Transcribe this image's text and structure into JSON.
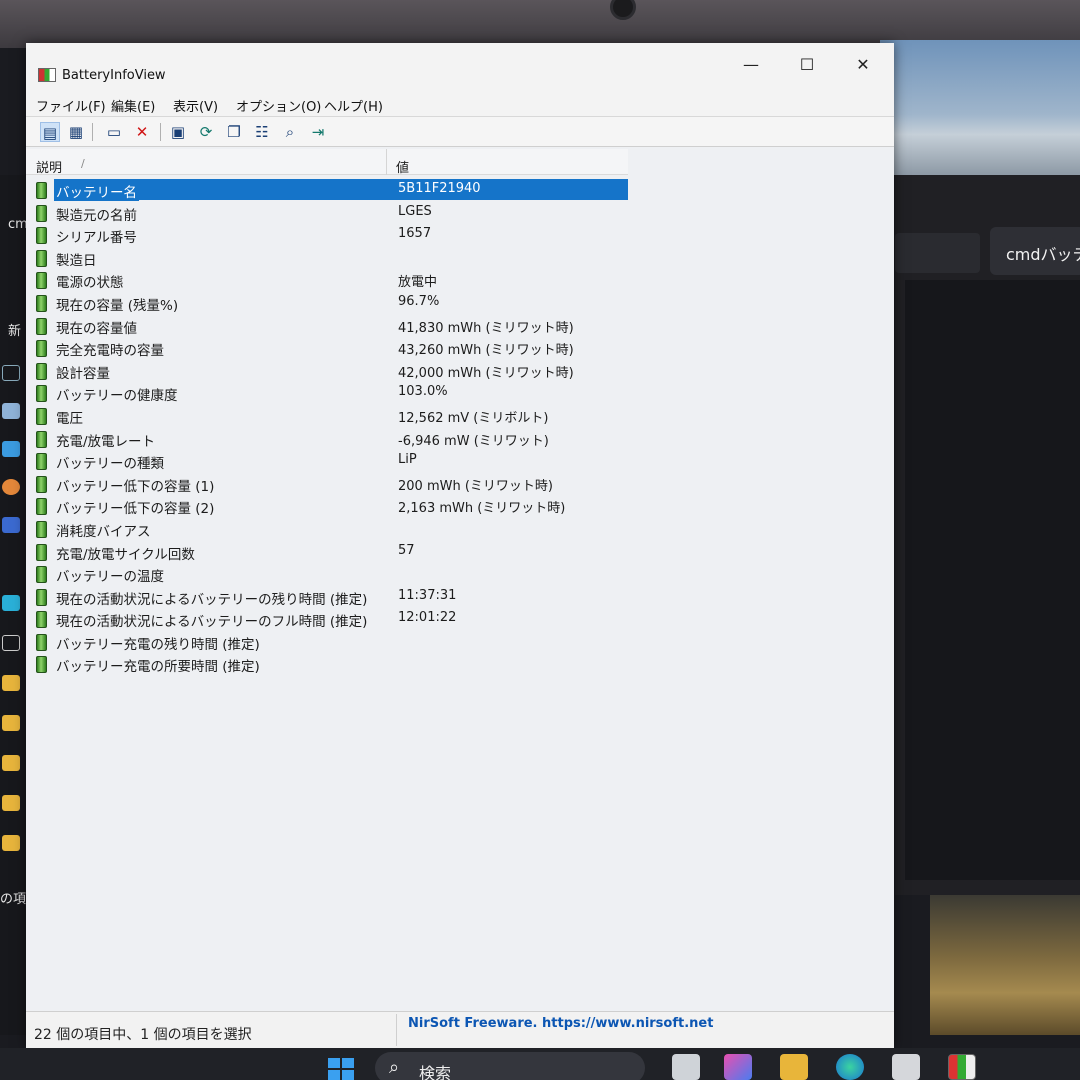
{
  "window": {
    "title": "BatteryInfoView",
    "minimize": "—",
    "maximize": "☐",
    "close": "✕"
  },
  "menu": [
    "ファイル(F)",
    "編集(E)",
    "表示(V)",
    "オプション(O)",
    "ヘルプ(H)"
  ],
  "columns": {
    "description": "説明",
    "sort_indicator": "∕",
    "value": "値"
  },
  "rows": [
    {
      "label": "バッテリー名",
      "value": "5B11F21940",
      "selected": true
    },
    {
      "label": "製造元の名前",
      "value": "LGES"
    },
    {
      "label": "シリアル番号",
      "value": "1657"
    },
    {
      "label": "製造日",
      "value": ""
    },
    {
      "label": "電源の状態",
      "value": "放電中"
    },
    {
      "label": "現在の容量 (残量%)",
      "value": "96.7%"
    },
    {
      "label": "現在の容量値",
      "value": "41,830 mWh (ミリワット時)"
    },
    {
      "label": "完全充電時の容量",
      "value": "43,260 mWh (ミリワット時)"
    },
    {
      "label": "設計容量",
      "value": "42,000 mWh (ミリワット時)"
    },
    {
      "label": "バッテリーの健康度",
      "value": "103.0%"
    },
    {
      "label": "電圧",
      "value": "12,562 mV (ミリボルト)"
    },
    {
      "label": "充電/放電レート",
      "value": "-6,946 mW (ミリワット)"
    },
    {
      "label": "バッテリーの種類",
      "value": "LiP"
    },
    {
      "label": "バッテリー低下の容量 (1)",
      "value": "200 mWh (ミリワット時)"
    },
    {
      "label": "バッテリー低下の容量 (2)",
      "value": "2,163 mWh (ミリワット時)"
    },
    {
      "label": "消耗度バイアス",
      "value": ""
    },
    {
      "label": "充電/放電サイクル回数",
      "value": "57"
    },
    {
      "label": "バッテリーの温度",
      "value": ""
    },
    {
      "label": "現在の活動状況によるバッテリーの残り時間 (推定)",
      "value": "11:37:31"
    },
    {
      "label": "現在の活動状況によるバッテリーのフル時間 (推定)",
      "value": "12:01:22"
    },
    {
      "label": "バッテリー充電の残り時間 (推定)",
      "value": ""
    },
    {
      "label": "バッテリー充電の所要時間 (推定)",
      "value": ""
    }
  ],
  "status": {
    "selection": "22 個の項目中、1 個の項目を選択",
    "link": "NirSoft Freeware. https://www.nirsoft.net"
  },
  "desktop": {
    "right_panel_button": "cmdバッテ",
    "left_labels": [
      "cm",
      "新",
      "の項"
    ]
  },
  "taskbar": {
    "search_label": "検索"
  }
}
